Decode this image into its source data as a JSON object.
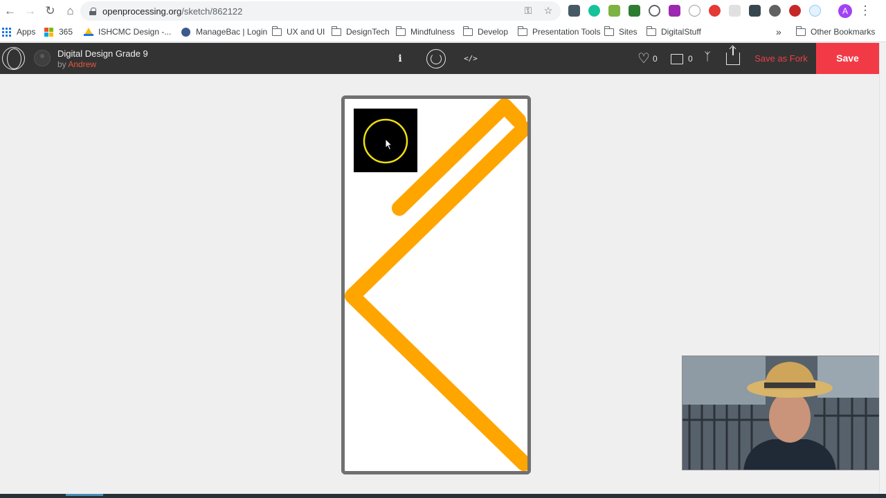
{
  "browser": {
    "url_host": "openprocessing.org",
    "url_path": "/sketch/862122",
    "profile_initial": "A"
  },
  "bookmarks": {
    "apps": "Apps",
    "ms365": "365",
    "ishcmc": "ISHCMC Design -...",
    "managebac": "ManageBac | Login",
    "uxui": "UX and UI",
    "designtech": "DesignTech",
    "mindfulness": "Mindfulness",
    "develop": "Develop",
    "presentation": "Presentation Tools",
    "sites": "Sites",
    "digitalstuff": "DigitalStuff",
    "overflow": "»",
    "other": "Other Bookmarks"
  },
  "sketch": {
    "title": "Digital Design Grade 9",
    "by_prefix": "by",
    "author": "Andrew",
    "info_label": "i",
    "code_label": "</>",
    "likes": "0",
    "comments": "0",
    "save_as_fork": "Save as Fork",
    "save": "Save"
  },
  "colors": {
    "accent": "#f23a47",
    "stroke_orange": "#ffa500",
    "ring_yellow": "#f0e010"
  }
}
